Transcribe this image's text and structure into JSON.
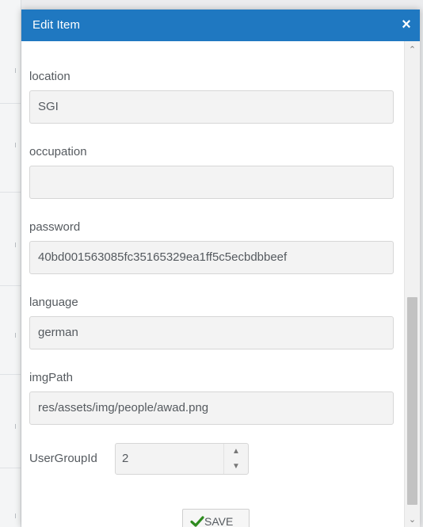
{
  "dialog": {
    "title": "Edit Item",
    "close_glyph": "×",
    "close_icon": "close-icon"
  },
  "fields": {
    "location": {
      "label": "location",
      "value": "SGI"
    },
    "occupation": {
      "label": "occupation",
      "value": ""
    },
    "password": {
      "label": "password",
      "value": "40bd001563085fc35165329ea1ff5c5ecbdbbeef"
    },
    "language": {
      "label": "language",
      "value": "german"
    },
    "imgPath": {
      "label": "imgPath",
      "value": "res/assets/img/people/awad.png"
    },
    "userGroupId": {
      "label": "UserGroupId",
      "value": "2"
    }
  },
  "stepper": {
    "up_glyph": "▲",
    "down_glyph": "▼"
  },
  "actions": {
    "save_label": "SAVE",
    "save_icon": "checkmark-icon"
  },
  "scrollbar": {
    "up_glyph": "⌃",
    "down_glyph": "⌄"
  },
  "colors": {
    "titlebar": "#1f78c1",
    "checkmark": "#2e8b1f",
    "input_bg": "#f3f3f3"
  }
}
